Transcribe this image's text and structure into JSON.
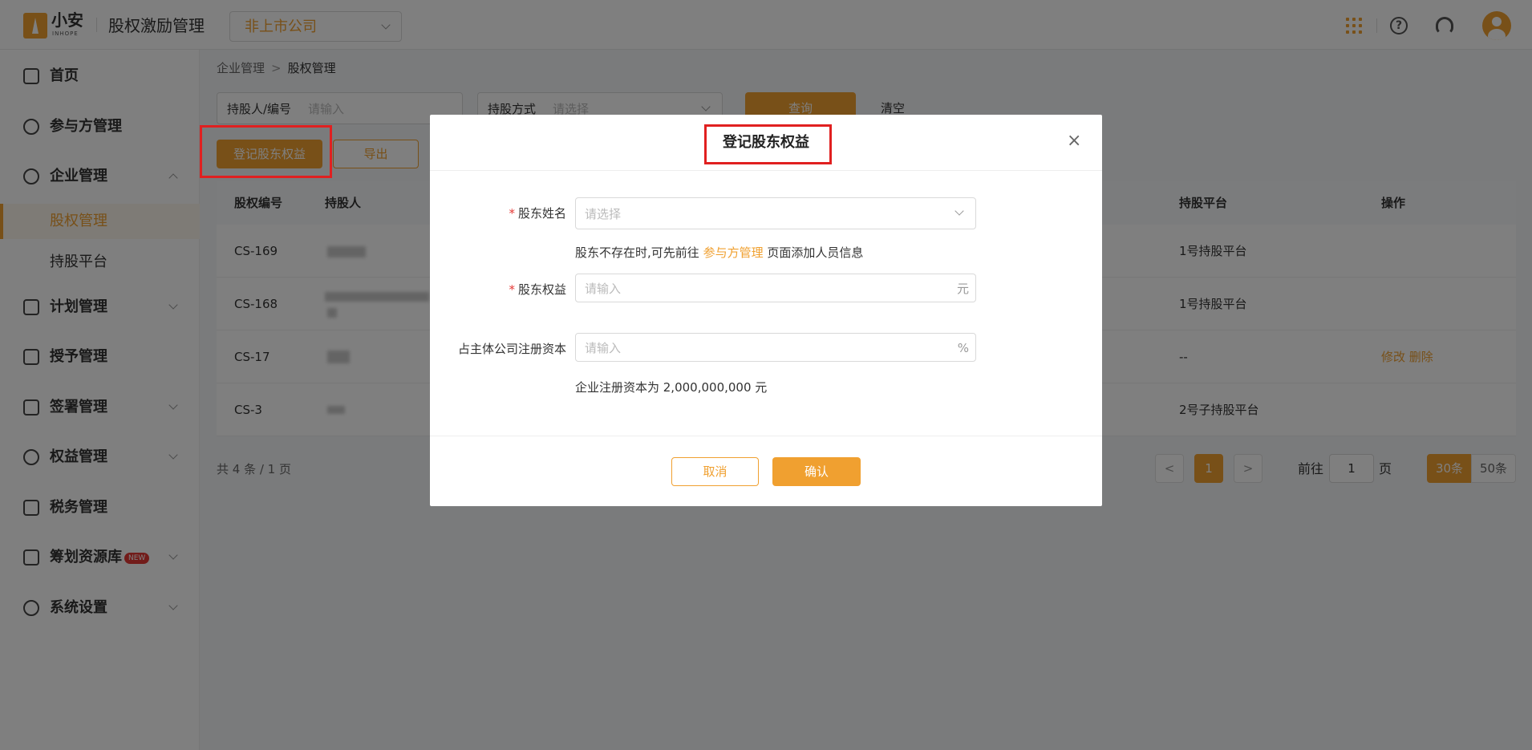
{
  "header": {
    "logo_text": "小安",
    "logo_sub": "INHOPE",
    "app_title": "股权激励管理",
    "company_select": "非上市公司",
    "icons": [
      "apps-grid-icon",
      "help-icon",
      "headset-icon",
      "avatar"
    ]
  },
  "sidebar": {
    "items": [
      {
        "label": "首页",
        "icon": "home-icon"
      },
      {
        "label": "参与方管理",
        "icon": "users-icon"
      },
      {
        "label": "企业管理",
        "icon": "enterprise-icon",
        "expanded": true
      },
      {
        "label": "股权管理",
        "sub": true,
        "active": true
      },
      {
        "label": "持股平台",
        "sub": true
      },
      {
        "label": "计划管理",
        "icon": "plan-icon"
      },
      {
        "label": "授予管理",
        "icon": "grant-icon"
      },
      {
        "label": "签署管理",
        "icon": "sign-icon"
      },
      {
        "label": "权益管理",
        "icon": "equity-icon"
      },
      {
        "label": "税务管理",
        "icon": "tax-icon"
      },
      {
        "label": "筹划资源库",
        "icon": "layers-icon",
        "badge": "NEW"
      },
      {
        "label": "系统设置",
        "icon": "settings-icon"
      }
    ]
  },
  "breadcrumb": {
    "parent": "企业管理",
    "current": "股权管理"
  },
  "filters": {
    "holder_label": "持股人/编号",
    "holder_placeholder": "请输入",
    "method_label": "持股方式",
    "method_placeholder": "请选择",
    "query": "查询",
    "clear": "清空"
  },
  "actions": {
    "register": "登记股东权益",
    "export": "导出"
  },
  "table": {
    "columns": {
      "id": "股权编号",
      "holder": "持股人",
      "platform": "持股平台",
      "ops": "操作"
    },
    "rows": [
      {
        "id": "CS-169",
        "platform": "1号持股平台",
        "ops": ""
      },
      {
        "id": "CS-168",
        "platform": "1号持股平台",
        "ops": ""
      },
      {
        "id": "CS-17",
        "platform": "--",
        "ops": "修改 删除"
      },
      {
        "id": "CS-3",
        "platform": "2号子持股平台",
        "ops": ""
      }
    ]
  },
  "pagination": {
    "total": "共 4 条 / 1 页",
    "current": "1",
    "goto_prefix": "前往",
    "goto_value": "1",
    "goto_suffix": "页",
    "size_30": "30条",
    "size_50": "50条"
  },
  "dialog": {
    "title": "登记股东权益",
    "close": "×",
    "name_label": "股东姓名",
    "name_placeholder": "请选择",
    "hint_prefix": "股东不存在时,可先前往",
    "hint_link": "参与方管理",
    "hint_suffix": "页面添加人员信息",
    "equity_label": "股东权益",
    "equity_placeholder": "请输入",
    "equity_unit": "元",
    "ratio_label": "占主体公司注册资本",
    "ratio_placeholder": "请输入",
    "ratio_unit": "%",
    "capital_hint": "企业注册资本为 2,000,000,000 元",
    "cancel": "取消",
    "confirm": "确认"
  },
  "colors": {
    "accent": "#f0a030",
    "annotation": "#e02020"
  }
}
